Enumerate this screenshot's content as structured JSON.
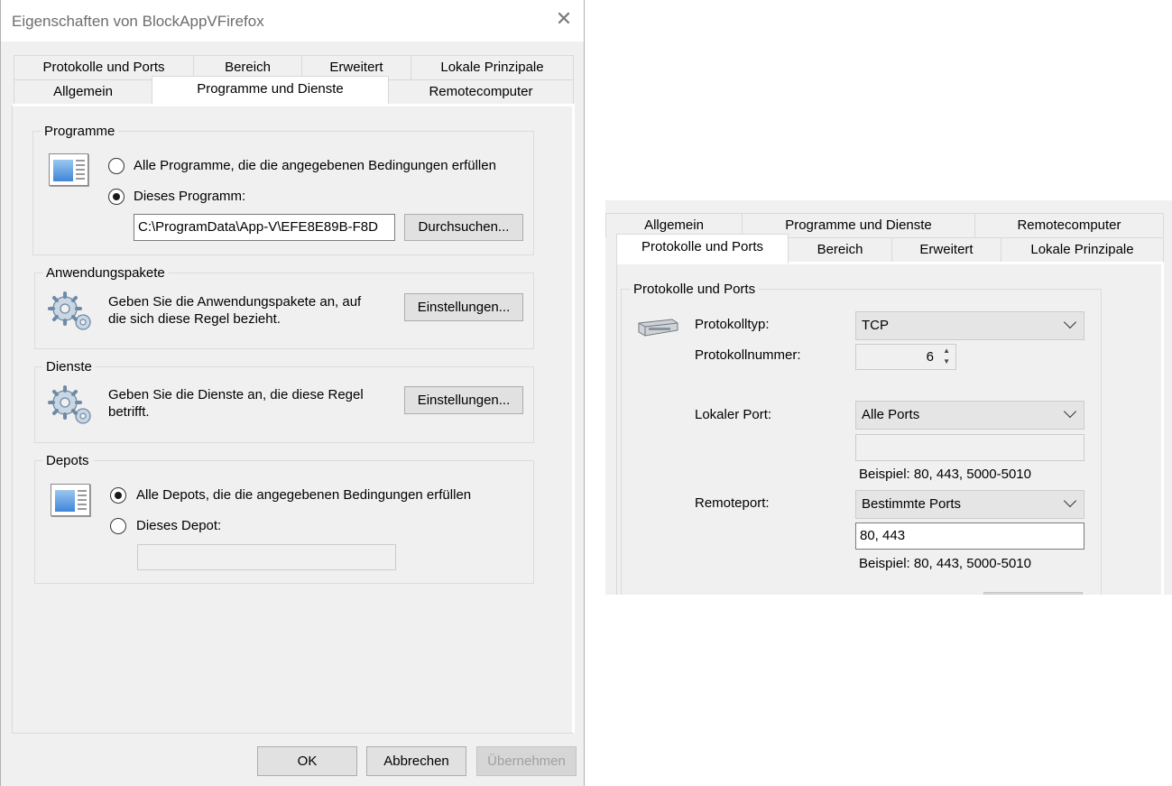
{
  "dialog": {
    "title": "Eigenschaften von BlockAppVFirefox",
    "close_glyph": "✕",
    "tabs_row1": [
      "Protokolle und Ports",
      "Bereich",
      "Erweitert",
      "Lokale Prinzipale"
    ],
    "tabs_row2": [
      "Allgemein",
      "Programme und Dienste",
      "Remotecomputer"
    ],
    "active_tab": "Programme und Dienste",
    "programs": {
      "group_label": "Programme",
      "option_all": "Alle Programme, die die angegebenen Bedingungen erfüllen",
      "option_this": "Dieses Programm:",
      "selected": "option_this",
      "path_value": "C:\\ProgramData\\App-V\\EFE8E89B-F8D",
      "browse_label": "Durchsuchen..."
    },
    "packages": {
      "group_label": "Anwendungspakete",
      "description_line1": "Geben Sie die Anwendungspakete an, auf",
      "description_line2": "die sich diese Regel bezieht.",
      "settings_label": "Einstellungen..."
    },
    "services": {
      "group_label": "Dienste",
      "description_line1": "Geben Sie die Dienste an, die diese Regel",
      "description_line2": "betrifft.",
      "settings_label": "Einstellungen..."
    },
    "depots": {
      "group_label": "Depots",
      "option_all": "Alle Depots, die die angegebenen Bedingungen erfüllen",
      "option_this": "Dieses Depot:",
      "selected": "option_all",
      "depot_value": ""
    },
    "footer": {
      "ok_label": "OK",
      "cancel_label": "Abbrechen",
      "apply_label": "Übernehmen"
    }
  },
  "protocols_panel": {
    "tabs_row1": [
      "Allgemein",
      "Programme und Dienste",
      "Remotecomputer"
    ],
    "tabs_row2": [
      "Protokolle und Ports",
      "Bereich",
      "Erweitert",
      "Lokale Prinzipale"
    ],
    "active_tab": "Protokolle und Ports",
    "group_label": "Protokolle und Ports",
    "protocol_type_label": "Protokolltyp:",
    "protocol_type_value": "TCP",
    "protocol_number_label": "Protokollnummer:",
    "protocol_number_value": "6",
    "local_port_label": "Lokaler Port:",
    "local_port_value": "Alle Ports",
    "local_port_input": "",
    "local_example": "Beispiel: 80, 443, 5000-5010",
    "remote_port_label": "Remoteport:",
    "remote_port_value": "Bestimmte Ports",
    "remote_port_input": "80, 443",
    "remote_example": "Beispiel: 80, 443, 5000-5010"
  }
}
